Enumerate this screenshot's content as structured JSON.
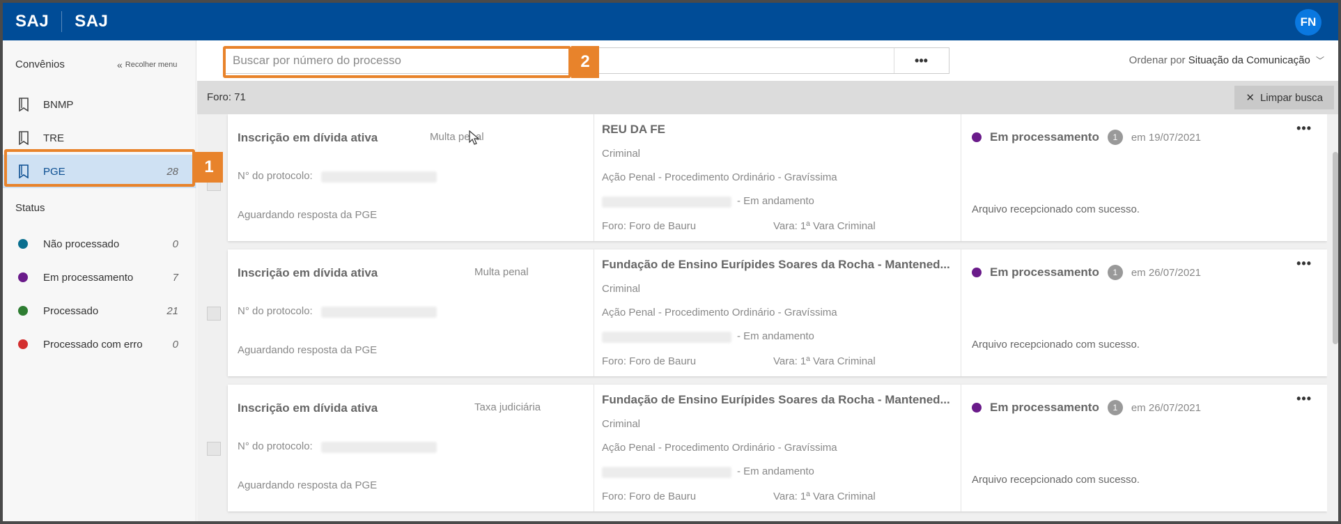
{
  "topbar": {
    "brand_primary": "SAJ",
    "brand_secondary": "SAJ",
    "avatar_initials": "FN"
  },
  "sidebar": {
    "header": "Convênios",
    "collapse_label": "Recolher menu",
    "convenios": [
      {
        "label": "BNMP",
        "count": ""
      },
      {
        "label": "TRE",
        "count": ""
      },
      {
        "label": "PGE",
        "count": "28"
      }
    ],
    "status_title": "Status",
    "statuses": [
      {
        "label": "Não processado",
        "count": "0",
        "color": "#0a6f8f"
      },
      {
        "label": "Em processamento",
        "count": "7",
        "color": "#6a1b8a"
      },
      {
        "label": "Processado",
        "count": "21",
        "color": "#2e7d32"
      },
      {
        "label": "Processado com erro",
        "count": "0",
        "color": "#d32f2f"
      }
    ]
  },
  "callouts": {
    "one": "1",
    "two": "2"
  },
  "search": {
    "placeholder": "Buscar por número do processo",
    "more": "•••"
  },
  "sort": {
    "prefix": "Ordenar por",
    "value": "Situação da Comunicação"
  },
  "filter": {
    "label": "Foro: 71",
    "clear_label": "Limpar busca"
  },
  "cards": [
    {
      "title": "Inscrição em dívida ativa",
      "type": "Multa penal",
      "protocol_label": "N° do protocolo:",
      "waiting": "Aguardando resposta da PGE",
      "party": "REU DA FE",
      "area": "Criminal",
      "action": "Ação Penal - Procedimento Ordinário - Gravíssima",
      "progress": "- Em andamento",
      "foro": "Foro: Foro de Bauru",
      "vara": "Vara: 1ª Vara Criminal",
      "status": "Em processamento",
      "status_color": "#6a1b8a",
      "badge": "1",
      "date": "em 19/07/2021",
      "message": "Arquivo recepcionado com sucesso.",
      "more": "•••"
    },
    {
      "title": "Inscrição em dívida ativa",
      "type": "Multa penal",
      "protocol_label": "N° do protocolo:",
      "waiting": "Aguardando resposta da PGE",
      "party": "Fundação de Ensino Eurípides Soares da Rocha - Mantened...",
      "area": "Criminal",
      "action": "Ação Penal - Procedimento Ordinário - Gravíssima",
      "progress": "- Em andamento",
      "foro": "Foro: Foro de Bauru",
      "vara": "Vara: 1ª Vara Criminal",
      "status": "Em processamento",
      "status_color": "#6a1b8a",
      "badge": "1",
      "date": "em 26/07/2021",
      "message": "Arquivo recepcionado com sucesso.",
      "more": "•••"
    },
    {
      "title": "Inscrição em dívida ativa",
      "type": "Taxa judiciária",
      "protocol_label": "N° do protocolo:",
      "waiting": "Aguardando resposta da PGE",
      "party": "Fundação de Ensino Eurípides Soares da Rocha - Mantened...",
      "area": "Criminal",
      "action": "Ação Penal - Procedimento Ordinário - Gravíssima",
      "progress": "- Em andamento",
      "foro": "Foro: Foro de Bauru",
      "vara": "Vara: 1ª Vara Criminal",
      "status": "Em processamento",
      "status_color": "#6a1b8a",
      "badge": "1",
      "date": "em 26/07/2021",
      "message": "Arquivo recepcionado com sucesso.",
      "more": "•••"
    }
  ]
}
